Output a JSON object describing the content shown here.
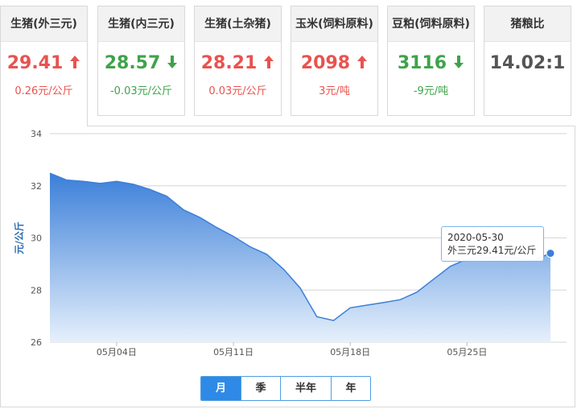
{
  "cards": [
    {
      "title": "生猪(外三元)",
      "price": "29.41",
      "trend": "up",
      "change": "0.26元/公斤"
    },
    {
      "title": "生猪(内三元)",
      "price": "28.57",
      "trend": "down",
      "change": "-0.03元/公斤"
    },
    {
      "title": "生猪(土杂猪)",
      "price": "28.21",
      "trend": "up",
      "change": "0.03元/公斤"
    },
    {
      "title": "玉米(饲料原料)",
      "price": "2098",
      "trend": "up",
      "change": "3元/吨"
    },
    {
      "title": "豆粕(饲料原料)",
      "price": "3116",
      "trend": "down",
      "change": "-9元/吨"
    },
    {
      "title": "猪粮比",
      "price": "14.02:1",
      "trend": "neutral",
      "change": ""
    }
  ],
  "colors": {
    "up": "#e8534f",
    "down": "#3ea34a",
    "series": "#3b7fd9",
    "area_top": "#3b7fd9",
    "area_bottom": "#e6f0fb",
    "active_button": "#2e8ae6"
  },
  "chart_data": {
    "type": "area",
    "ylabel": "元/公斤",
    "ylim": [
      26,
      34
    ],
    "yticks": [
      26,
      28,
      30,
      32,
      34
    ],
    "xlim": [
      "2020-04-30",
      "2020-05-30"
    ],
    "xticks": [
      {
        "date": "2020-05-04",
        "label": "05月04日"
      },
      {
        "date": "2020-05-11",
        "label": "05月11日"
      },
      {
        "date": "2020-05-18",
        "label": "05月18日"
      },
      {
        "date": "2020-05-25",
        "label": "05月25日"
      }
    ],
    "grid": true,
    "series": [
      {
        "points": [
          {
            "x": "2020-04-30",
            "y": 32.48
          },
          {
            "x": "2020-05-01",
            "y": 32.22
          },
          {
            "x": "2020-05-02",
            "y": 32.17
          },
          {
            "x": "2020-05-03",
            "y": 32.09
          },
          {
            "x": "2020-05-04",
            "y": 32.17
          },
          {
            "x": "2020-05-05",
            "y": 32.06
          },
          {
            "x": "2020-05-06",
            "y": 31.86
          },
          {
            "x": "2020-05-07",
            "y": 31.6
          },
          {
            "x": "2020-05-08",
            "y": 31.08
          },
          {
            "x": "2020-05-09",
            "y": 30.78
          },
          {
            "x": "2020-05-10",
            "y": 30.4
          },
          {
            "x": "2020-05-11",
            "y": 30.06
          },
          {
            "x": "2020-05-12",
            "y": 29.66
          },
          {
            "x": "2020-05-13",
            "y": 29.37
          },
          {
            "x": "2020-05-14",
            "y": 28.8
          },
          {
            "x": "2020-05-15",
            "y": 28.08
          },
          {
            "x": "2020-05-16",
            "y": 26.98
          },
          {
            "x": "2020-05-17",
            "y": 26.83
          },
          {
            "x": "2020-05-18",
            "y": 27.32
          },
          {
            "x": "2020-05-19",
            "y": 27.42
          },
          {
            "x": "2020-05-20",
            "y": 27.52
          },
          {
            "x": "2020-05-21",
            "y": 27.63
          },
          {
            "x": "2020-05-22",
            "y": 27.92
          },
          {
            "x": "2020-05-23",
            "y": 28.42
          },
          {
            "x": "2020-05-24",
            "y": 28.91
          },
          {
            "x": "2020-05-25",
            "y": 29.19
          },
          {
            "x": "2020-05-26",
            "y": 29.23
          },
          {
            "x": "2020-05-27",
            "y": 29.28
          },
          {
            "x": "2020-05-28",
            "y": 29.22
          },
          {
            "x": "2020-05-29",
            "y": 29.15
          },
          {
            "x": "2020-05-30",
            "y": 29.41
          }
        ]
      }
    ],
    "tooltip": {
      "date": "2020-05-30",
      "text": "外三元29.41元/公斤"
    }
  },
  "range_buttons": [
    {
      "label": "月",
      "active": true
    },
    {
      "label": "季",
      "active": false
    },
    {
      "label": "半年",
      "active": false
    },
    {
      "label": "年",
      "active": false
    }
  ]
}
